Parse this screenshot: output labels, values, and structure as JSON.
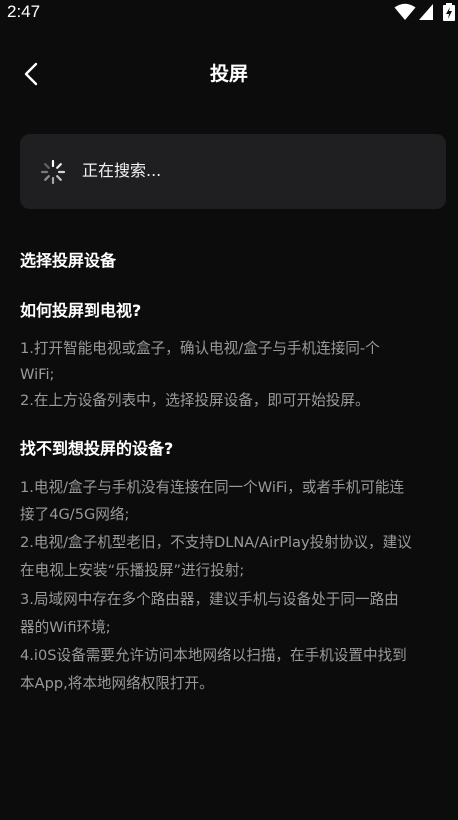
{
  "status_bar": {
    "time": "2:47",
    "icons": [
      "wifi-icon",
      "signal-icon",
      "battery-charging-icon"
    ]
  },
  "header": {
    "title": "投屏",
    "back_icon": "chevron-left-icon"
  },
  "search": {
    "status_text": "正在搜索...",
    "spinner_icon": "loading-spinner-icon"
  },
  "device_section": {
    "title": "选择投屏设备"
  },
  "help_how": {
    "title": "如何投屏到电视?",
    "lines": [
      "1.打开智能电视或盒子，确认电视/盒子与手机连接同-个",
      "WiFi;",
      "2.在上方设备列表中，选择投屏设备，即可开始投屏。"
    ]
  },
  "help_not_found": {
    "title": "找不到想投屏的设备?",
    "lines": [
      "1.电视/盒子与手机没有连接在同一个WiFi，或者手机可能连",
      "接了4G/5G网络;",
      "2.电视/盒子机型老旧，不支持DLNA/AirPlay投射协议，建议",
      "在电视上安装“乐播投屏”进行投射;",
      "3.局域网中存在多个路由器，建议手机与设备处于同一路由",
      "器的Wifi环境;",
      "4.i0S设备需要允许访问本地网络以扫描，在手机设置中找到",
      "本App,将本地网络权限打开。"
    ]
  },
  "colors": {
    "background": "#0c0c0d",
    "card": "#1f1f21",
    "primary_text": "#ffffff",
    "secondary_text": "#9a9a9c"
  }
}
